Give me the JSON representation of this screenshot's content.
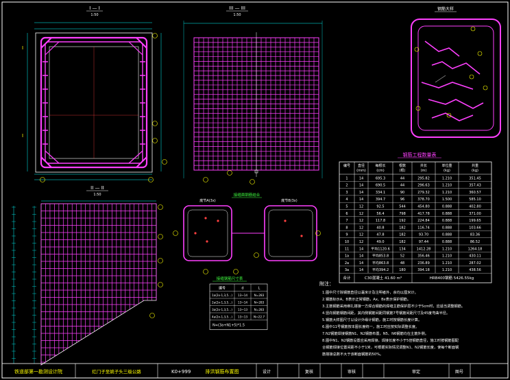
{
  "sections": {
    "s1_title": "I — I",
    "s1_scale": "1:50",
    "s2_title": "III — III",
    "s2_scale": "1:50",
    "s3_title": "II — II",
    "s3_scale": "1:50",
    "detail_title": "钢筋大样",
    "joint_title": "接缝面钢筋结合",
    "slab_left": "底节A(3x)",
    "slab_right": "底节B(3x)"
  },
  "table": {
    "title": "钢筋工程数量表",
    "headers": [
      "编号",
      "直径\n(mm)",
      "每根长\n(cm)",
      "根数\n(根)",
      "共长\n(m)",
      "单位重\n(kg)",
      "共重\n(kg)"
    ],
    "rows": [
      [
        "1",
        "14",
        "695.3",
        "44",
        "295.82",
        "1.210",
        "351.45"
      ],
      [
        "2",
        "14",
        "690.5",
        "44",
        "296.63",
        "1.210",
        "357.43"
      ],
      [
        "3",
        "14",
        "334.1",
        "90",
        "279.32",
        "1.210",
        "360.57"
      ],
      [
        "4",
        "14",
        "394.7",
        "96",
        "378.70",
        "1.500",
        "585.10"
      ],
      [
        "5",
        "12",
        "92.5",
        "544",
        "454.80",
        "0.888",
        "402.80"
      ],
      [
        "6",
        "12",
        "56.4",
        "798",
        "417.78",
        "0.888",
        "371.00"
      ],
      [
        "7",
        "12",
        "117.8",
        "192",
        "224.84",
        "0.888",
        "199.65"
      ],
      [
        "8",
        "12",
        "40.8",
        "182",
        "116.74",
        "0.888",
        "103.66"
      ],
      [
        "9",
        "12",
        "47.8",
        "182",
        "93.70",
        "0.888",
        "83.36"
      ],
      [
        "10",
        "12",
        "49.0",
        "182",
        "97.44",
        "0.888",
        "86.52"
      ],
      [
        "11",
        "14",
        "平均1120.6",
        "134",
        "1412.28",
        "1.210",
        "1264.18"
      ],
      [
        "1a",
        "14",
        "平均853.8",
        "52",
        "356.46",
        "1.210",
        "430.11"
      ],
      [
        "2a",
        "14",
        "平均863.8",
        "48",
        "236.89",
        "1.210",
        "287.02"
      ],
      [
        "3a",
        "14",
        "平均394.2",
        "180",
        "394.18",
        "1.210",
        "438.56"
      ]
    ],
    "total_label": "合计",
    "total_concrete": "C30混凝土 41.60 m³",
    "total_steel": "HRB400钢筋 5426.55kg"
  },
  "small_table": {
    "title": "接缝钢筋尺寸表",
    "headers": [
      "编号",
      "d",
      "L"
    ],
    "rows": [
      [
        "1a(2x-1,3,5…)",
        "13~14",
        "N=283"
      ],
      [
        "2a(2x-1,3,5…)",
        "13~14",
        "N=283"
      ],
      [
        "3a(2x-1,3,5…)",
        "13~13",
        "N=283"
      ],
      [
        "4a(2x-1,3,5…)",
        "13~13",
        "N=22.7"
      ]
    ],
    "formula": "N=(3a+N1+5)*1.5"
  },
  "notes": {
    "title": "附注：",
    "lines": [
      "1.图中尺寸除钢筋直径以毫米计及注明者外，余均以厘米计。",
      "2.钢筋标示A、B表示正常钢筋，Ax、Bx表示保护钢筋。",
      "3.主筋钢筋采用绑扎搭接一方焊合钢筋的焊缝主筋保护层不少于5cm时，应适当调整钢筋。",
      "4.竖向钢筋钢筋间距，其内侧钢筋间距同钢筋7号钢筋间距尺寸及45度弯曲半径。",
      "5.钢筋大样图尺寸以设计外缘计钢筋，施工时按钢筋长度计算。",
      "6.图中11号钢筋按本图长度统一，施工时应按实际调整长度。",
      "7.N2钢筋焊接钢筋N1、N2钢筋布置，N5、N6钢筋均在主筋外侧。",
      "8.图中N1、N2钢筋设置应采用焊接，焊接长度不小于5倍钢筋直径，施工时按钢筋图配",
      "合钢筋焊接位置间距不小于1米，可根据实际情况调整N1、N2钢筋长度，使每个断面钢",
      "筋搭接总数不大于该断面钢筋的50%。"
    ]
  },
  "titleblock": {
    "institute": "铁道部第一勘测设计院",
    "project": "红门子至姚子头三级公路",
    "station": "K0+999",
    "drawing_name": "排洪钢筋布置图",
    "label_design": "设计",
    "label_check": "复核",
    "label_review": "审核",
    "label_approve": "审定",
    "label_drawing_no": "图号"
  },
  "colors": {
    "frame": "#ffffff",
    "rebar": "#ff40ff",
    "dimension": "#00ffff",
    "label": "#ffff00",
    "accent": "#ff4040",
    "green": "#40ff40"
  }
}
